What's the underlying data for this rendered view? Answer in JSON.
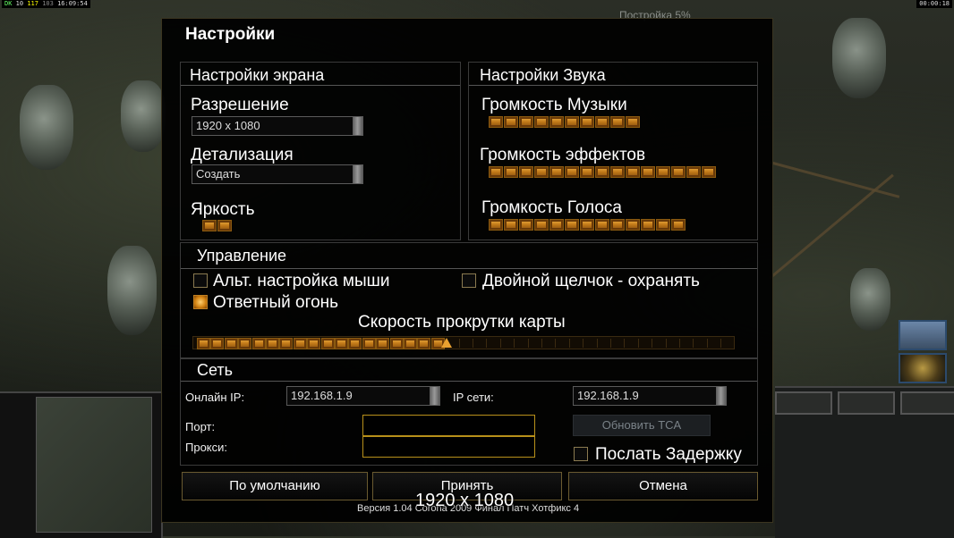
{
  "hud": {
    "fps_label": "DK",
    "fps_a": "10",
    "fps_b": "117",
    "fps_c": "103",
    "clock": "16:09:54",
    "game_timer": "00:00:18",
    "build_status": "Постройка  5%"
  },
  "dialog": {
    "title": "Настройки",
    "screen": {
      "title": "Настройки экрана",
      "resolution_label": "Разрешение",
      "resolution_value": "1920 x 1080",
      "detail_label": "Детализация",
      "detail_value": "Создать",
      "brightness_label": "Яркость",
      "brightness_level": 2
    },
    "sound": {
      "title": "Настройки Звука",
      "music_label": "Громкость Музыки",
      "music_level": 10,
      "effects_label": "Громкость эффектов",
      "effects_level": 15,
      "voice_label": "Громкость Голоса",
      "voice_level": 13
    },
    "controls": {
      "title": "Управление",
      "alt_mouse_label": "Альт. настройка мыши",
      "alt_mouse_checked": false,
      "double_click_label": "Двойной щелчок - охранять",
      "double_click_checked": false,
      "return_fire_label": "Ответный огонь",
      "return_fire_checked": true,
      "scroll_speed_label": "Скорость прокрутки карты",
      "scroll_speed_level": 18,
      "scroll_speed_max": 39
    },
    "network": {
      "title": "Сеть",
      "online_ip_label": "Онлайн IP:",
      "online_ip_value": "192.168.1.9",
      "net_ip_label": "IP сети:",
      "net_ip_value": "192.168.1.9",
      "port_label": "Порт:",
      "port_value": "",
      "proxy_label": "Прокси:",
      "proxy_value": "",
      "update_tca_label": "Обновить TCA",
      "send_delay_label": "Послать Задержку",
      "send_delay_checked": false
    },
    "buttons": {
      "defaults": "По умолчанию",
      "accept": "Принять",
      "cancel": "Отмена"
    },
    "version": "Версия 1.04 Corona 2009 Финал Патч Хотфикс 4",
    "resolution_overlay": "1920 x 1080"
  },
  "colors": {
    "segment_fill": "#e09a2c",
    "field_border": "#b8901a",
    "dialog_bg": "#000000"
  }
}
